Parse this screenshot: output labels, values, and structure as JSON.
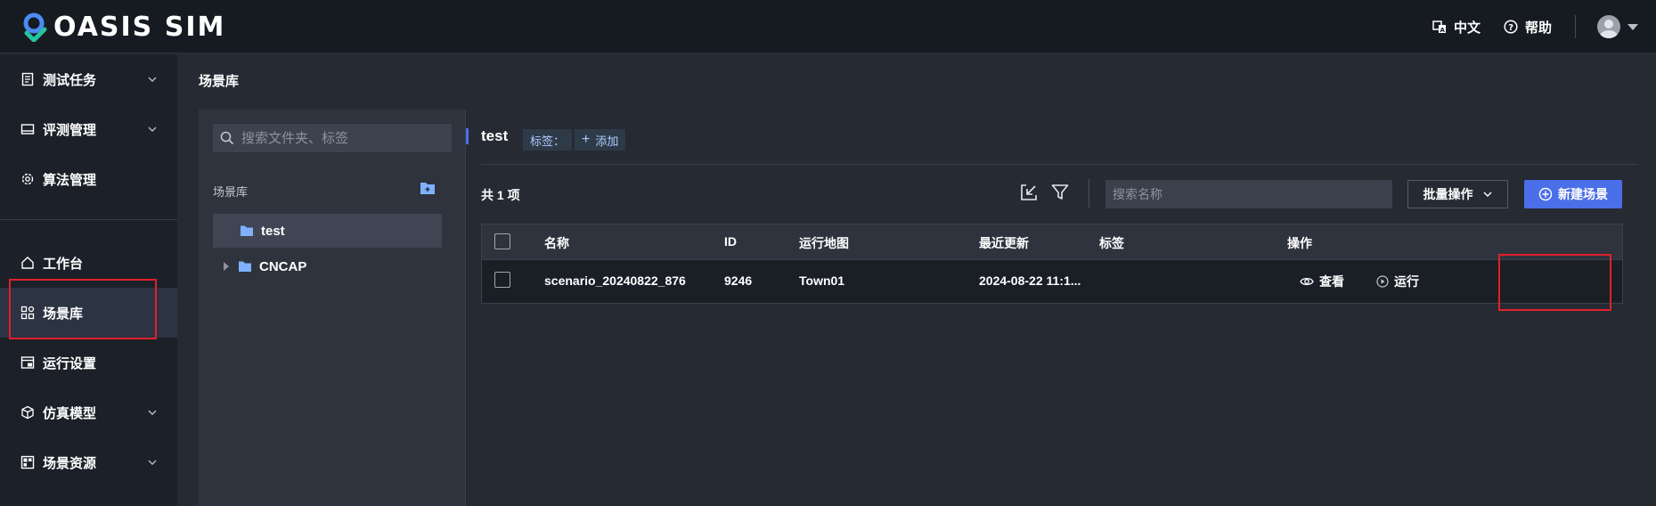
{
  "app": {
    "logo_text": "OASIS SIM"
  },
  "topbar": {
    "language": "中文",
    "help": "帮助"
  },
  "sidebar": {
    "items": [
      {
        "label": "测试任务",
        "icon": "task-icon",
        "expandable": true
      },
      {
        "label": "评测管理",
        "icon": "evaluation-icon",
        "expandable": true
      },
      {
        "label": "算法管理",
        "icon": "algorithm-gear-icon",
        "expandable": false
      },
      {
        "label": "工作台",
        "icon": "home-icon",
        "expandable": false
      },
      {
        "label": "场景库",
        "icon": "apps-grid-icon",
        "expandable": false,
        "active": true
      },
      {
        "label": "运行设置",
        "icon": "run-settings-icon",
        "expandable": false
      },
      {
        "label": "仿真模型",
        "icon": "cube-icon",
        "expandable": true
      },
      {
        "label": "场景资源",
        "icon": "resource-grid-icon",
        "expandable": true
      }
    ]
  },
  "breadcrumb": "场景库",
  "tree": {
    "search_placeholder": "搜索文件夹、标签",
    "title": "场景库",
    "nodes": [
      {
        "label": "test",
        "selected": true
      },
      {
        "label": "CNCAP",
        "selected": false,
        "collapsed": true
      }
    ]
  },
  "folder": {
    "title": "test",
    "tag_label": "标签：",
    "tag_add": "添加"
  },
  "toolbar": {
    "count": "共 1 项",
    "search_placeholder": "搜索名称",
    "batch": "批量操作",
    "new_scene": "新建场景"
  },
  "table": {
    "columns": [
      "名称",
      "ID",
      "运行地图",
      "最近更新",
      "标签",
      "操作"
    ],
    "rows": [
      {
        "name": "scenario_20240822_876",
        "id": "9246",
        "map": "Town01",
        "updated": "2024-08-22 11:1...",
        "tags": "",
        "actions": {
          "view": "查看",
          "run": "运行"
        }
      }
    ]
  },
  "colors": {
    "accent": "#4b6fe8",
    "highlight": "#e0202a",
    "bg": "#262a33"
  }
}
